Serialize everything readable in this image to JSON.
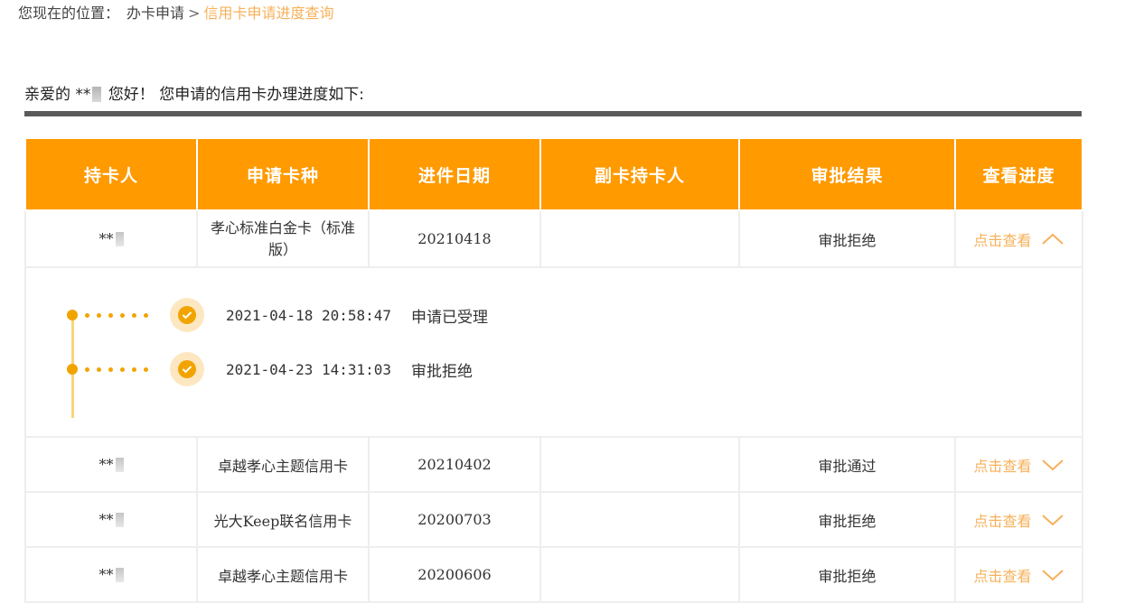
{
  "breadcrumb": {
    "label": "您现在的位置：",
    "parent": "办卡申请",
    "separator": ">",
    "current": "信用卡申请进度查询"
  },
  "greeting": {
    "prefix": "亲爱的 **",
    "suffix": "您好！ 您申请的信用卡办理进度如下:"
  },
  "table": {
    "headers": [
      "持卡人",
      "申请卡种",
      "进件日期",
      "副卡持卡人",
      "审批结果",
      "查看进度"
    ],
    "rows": [
      {
        "holder": "**",
        "card": "孝心标准白金卡（标准版）",
        "date": "20210418",
        "sub_holder": "",
        "result": "审批拒绝",
        "result_status": "reject",
        "link": "点击查看",
        "expanded": true
      },
      {
        "holder": "**",
        "card": "卓越孝心主题信用卡",
        "date": "20210402",
        "sub_holder": "",
        "result": "审批通过",
        "result_status": "pass",
        "link": "点击查看",
        "expanded": false
      },
      {
        "holder": "**",
        "card": "光大Keep联名信用卡",
        "date": "20200703",
        "sub_holder": "",
        "result": "审批拒绝",
        "result_status": "reject",
        "link": "点击查看",
        "expanded": false
      },
      {
        "holder": "**",
        "card": "卓越孝心主题信用卡",
        "date": "20200606",
        "sub_holder": "",
        "result": "审批拒绝",
        "result_status": "reject",
        "link": "点击查看",
        "expanded": false
      }
    ],
    "timeline": [
      {
        "time": "2021-04-18 20:58:47",
        "status": "申请已受理"
      },
      {
        "time": "2021-04-23 14:31:03",
        "status": "审批拒绝"
      }
    ]
  },
  "colors": {
    "accent": "#ff9a00",
    "reject": "#e23b3b",
    "link": "#f6b15a",
    "divider": "#5b5b5b"
  },
  "icons": {
    "expanded": "chevron-up-icon",
    "collapsed": "chevron-down-icon",
    "timeline": "check-circle-icon"
  }
}
